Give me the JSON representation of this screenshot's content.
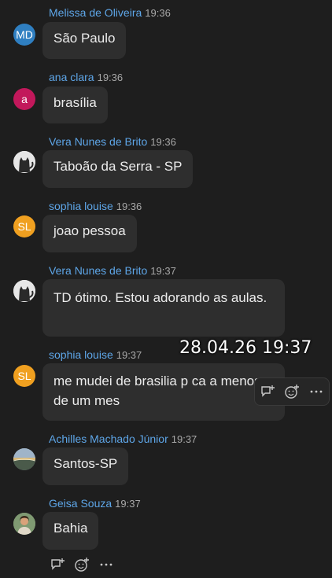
{
  "messages": [
    {
      "name": "Melissa de Oliveira",
      "time": "19:36",
      "text": "São Paulo",
      "avatar": {
        "initials": "MD",
        "color": "#2f7fc1"
      }
    },
    {
      "name": "ana clara",
      "time": "19:36",
      "text": "brasília",
      "avatar": {
        "initials": "a",
        "color": "#c2185b"
      }
    },
    {
      "name": "Vera Nunes de Brito",
      "time": "19:36",
      "text": "Taboão da Serra - SP",
      "avatar": {
        "initials": "",
        "color": "#e9e9e9",
        "kind": "cat-photo"
      }
    },
    {
      "name": "sophia louise",
      "time": "19:36",
      "text": "joao pessoa",
      "avatar": {
        "initials": "SL",
        "color": "#f0a020"
      }
    },
    {
      "name": "Vera Nunes de Brito",
      "time": "19:37",
      "text": "TD ótimo. Estou adorando as aulas.",
      "avatar": {
        "initials": "",
        "color": "#e9e9e9",
        "kind": "cat-photo"
      }
    },
    {
      "name": "sophia louise",
      "time": "19:37",
      "text": "me mudei de brasilia p ca a menos de um mes",
      "avatar": {
        "initials": "SL",
        "color": "#f0a020"
      }
    },
    {
      "name": "Achilles Machado Júnior",
      "time": "19:37",
      "text": "Santos-SP",
      "avatar": {
        "initials": "",
        "color": "#7a8a9a",
        "kind": "landscape-photo"
      }
    },
    {
      "name": "Geisa Souza",
      "time": "19:37",
      "text": "Bahia",
      "avatar": {
        "initials": "",
        "color": "#8a9a7a",
        "kind": "person-photo"
      }
    }
  ],
  "overlay_timestamp": "28.04.26 19:37",
  "actions": {
    "reply_icon": "reply-plus-icon",
    "react_icon": "emoji-add-icon",
    "more_icon": "more-dots-icon"
  },
  "colors": {
    "background": "#1e1e1e",
    "bubble": "#2e2e2e",
    "name": "#5ea6e8",
    "time": "#a8a8a8"
  }
}
